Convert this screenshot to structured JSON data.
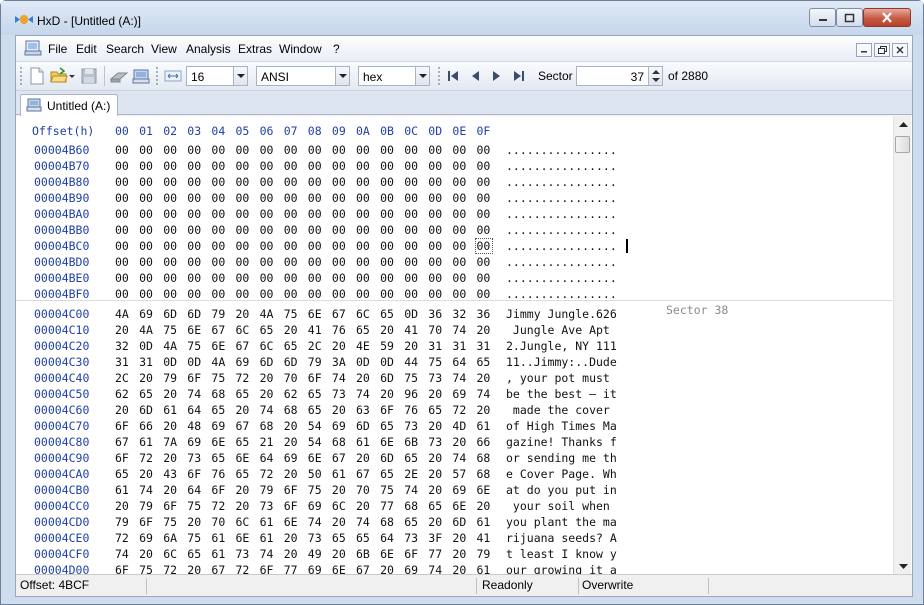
{
  "window": {
    "title": "HxD - [Untitled (A:)]",
    "icon": "hxd-app-icon"
  },
  "menu": {
    "items": [
      "File",
      "Edit",
      "Search",
      "View",
      "Analysis",
      "Extras",
      "Window",
      "?"
    ]
  },
  "toolbar": {
    "bytes_per_row": "16",
    "charset": "ANSI",
    "offset_base": "hex",
    "sector_label": "Sector",
    "sector_value": "37",
    "sector_total": "of 2880"
  },
  "tab": {
    "label": "Untitled (A:)"
  },
  "editor": {
    "offset_header": "Offset(h)",
    "column_headers": [
      "00",
      "01",
      "02",
      "03",
      "04",
      "05",
      "06",
      "07",
      "08",
      "09",
      "0A",
      "0B",
      "0C",
      "0D",
      "0E",
      "0F"
    ],
    "sector_marker": "Sector 38",
    "rows": [
      {
        "offset": "00004B60",
        "bytes": [
          "00",
          "00",
          "00",
          "00",
          "00",
          "00",
          "00",
          "00",
          "00",
          "00",
          "00",
          "00",
          "00",
          "00",
          "00",
          "00"
        ],
        "text": "................"
      },
      {
        "offset": "00004B70",
        "bytes": [
          "00",
          "00",
          "00",
          "00",
          "00",
          "00",
          "00",
          "00",
          "00",
          "00",
          "00",
          "00",
          "00",
          "00",
          "00",
          "00"
        ],
        "text": "................"
      },
      {
        "offset": "00004B80",
        "bytes": [
          "00",
          "00",
          "00",
          "00",
          "00",
          "00",
          "00",
          "00",
          "00",
          "00",
          "00",
          "00",
          "00",
          "00",
          "00",
          "00"
        ],
        "text": "................"
      },
      {
        "offset": "00004B90",
        "bytes": [
          "00",
          "00",
          "00",
          "00",
          "00",
          "00",
          "00",
          "00",
          "00",
          "00",
          "00",
          "00",
          "00",
          "00",
          "00",
          "00"
        ],
        "text": "................"
      },
      {
        "offset": "00004BA0",
        "bytes": [
          "00",
          "00",
          "00",
          "00",
          "00",
          "00",
          "00",
          "00",
          "00",
          "00",
          "00",
          "00",
          "00",
          "00",
          "00",
          "00"
        ],
        "text": "................"
      },
      {
        "offset": "00004BB0",
        "bytes": [
          "00",
          "00",
          "00",
          "00",
          "00",
          "00",
          "00",
          "00",
          "00",
          "00",
          "00",
          "00",
          "00",
          "00",
          "00",
          "00"
        ],
        "text": "................"
      },
      {
        "offset": "00004BC0",
        "bytes": [
          "00",
          "00",
          "00",
          "00",
          "00",
          "00",
          "00",
          "00",
          "00",
          "00",
          "00",
          "00",
          "00",
          "00",
          "00",
          "00"
        ],
        "text": "................"
      },
      {
        "offset": "00004BD0",
        "bytes": [
          "00",
          "00",
          "00",
          "00",
          "00",
          "00",
          "00",
          "00",
          "00",
          "00",
          "00",
          "00",
          "00",
          "00",
          "00",
          "00"
        ],
        "text": "................"
      },
      {
        "offset": "00004BE0",
        "bytes": [
          "00",
          "00",
          "00",
          "00",
          "00",
          "00",
          "00",
          "00",
          "00",
          "00",
          "00",
          "00",
          "00",
          "00",
          "00",
          "00"
        ],
        "text": "................"
      },
      {
        "offset": "00004BF0",
        "bytes": [
          "00",
          "00",
          "00",
          "00",
          "00",
          "00",
          "00",
          "00",
          "00",
          "00",
          "00",
          "00",
          "00",
          "00",
          "00",
          "00"
        ],
        "text": "................"
      },
      {
        "offset": "00004C00",
        "bytes": [
          "4A",
          "69",
          "6D",
          "6D",
          "79",
          "20",
          "4A",
          "75",
          "6E",
          "67",
          "6C",
          "65",
          "0D",
          "36",
          "32",
          "36"
        ],
        "text": "Jimmy Jungle.626"
      },
      {
        "offset": "00004C10",
        "bytes": [
          "20",
          "4A",
          "75",
          "6E",
          "67",
          "6C",
          "65",
          "20",
          "41",
          "76",
          "65",
          "20",
          "41",
          "70",
          "74",
          "20"
        ],
        "text": " Jungle Ave Apt "
      },
      {
        "offset": "00004C20",
        "bytes": [
          "32",
          "0D",
          "4A",
          "75",
          "6E",
          "67",
          "6C",
          "65",
          "2C",
          "20",
          "4E",
          "59",
          "20",
          "31",
          "31",
          "31"
        ],
        "text": "2.Jungle, NY 111"
      },
      {
        "offset": "00004C30",
        "bytes": [
          "31",
          "31",
          "0D",
          "0D",
          "4A",
          "69",
          "6D",
          "6D",
          "79",
          "3A",
          "0D",
          "0D",
          "44",
          "75",
          "64",
          "65"
        ],
        "text": "11..Jimmy:..Dude"
      },
      {
        "offset": "00004C40",
        "bytes": [
          "2C",
          "20",
          "79",
          "6F",
          "75",
          "72",
          "20",
          "70",
          "6F",
          "74",
          "20",
          "6D",
          "75",
          "73",
          "74",
          "20"
        ],
        "text": ", your pot must "
      },
      {
        "offset": "00004C50",
        "bytes": [
          "62",
          "65",
          "20",
          "74",
          "68",
          "65",
          "20",
          "62",
          "65",
          "73",
          "74",
          "20",
          "96",
          "20",
          "69",
          "74"
        ],
        "text": "be the best – it"
      },
      {
        "offset": "00004C60",
        "bytes": [
          "20",
          "6D",
          "61",
          "64",
          "65",
          "20",
          "74",
          "68",
          "65",
          "20",
          "63",
          "6F",
          "76",
          "65",
          "72",
          "20"
        ],
        "text": " made the cover "
      },
      {
        "offset": "00004C70",
        "bytes": [
          "6F",
          "66",
          "20",
          "48",
          "69",
          "67",
          "68",
          "20",
          "54",
          "69",
          "6D",
          "65",
          "73",
          "20",
          "4D",
          "61"
        ],
        "text": "of High Times Ma"
      },
      {
        "offset": "00004C80",
        "bytes": [
          "67",
          "61",
          "7A",
          "69",
          "6E",
          "65",
          "21",
          "20",
          "54",
          "68",
          "61",
          "6E",
          "6B",
          "73",
          "20",
          "66"
        ],
        "text": "gazine! Thanks f"
      },
      {
        "offset": "00004C90",
        "bytes": [
          "6F",
          "72",
          "20",
          "73",
          "65",
          "6E",
          "64",
          "69",
          "6E",
          "67",
          "20",
          "6D",
          "65",
          "20",
          "74",
          "68"
        ],
        "text": "or sending me th"
      },
      {
        "offset": "00004CA0",
        "bytes": [
          "65",
          "20",
          "43",
          "6F",
          "76",
          "65",
          "72",
          "20",
          "50",
          "61",
          "67",
          "65",
          "2E",
          "20",
          "57",
          "68"
        ],
        "text": "e Cover Page. Wh"
      },
      {
        "offset": "00004CB0",
        "bytes": [
          "61",
          "74",
          "20",
          "64",
          "6F",
          "20",
          "79",
          "6F",
          "75",
          "20",
          "70",
          "75",
          "74",
          "20",
          "69",
          "6E"
        ],
        "text": "at do you put in"
      },
      {
        "offset": "00004CC0",
        "bytes": [
          "20",
          "79",
          "6F",
          "75",
          "72",
          "20",
          "73",
          "6F",
          "69",
          "6C",
          "20",
          "77",
          "68",
          "65",
          "6E",
          "20"
        ],
        "text": " your soil when "
      },
      {
        "offset": "00004CD0",
        "bytes": [
          "79",
          "6F",
          "75",
          "20",
          "70",
          "6C",
          "61",
          "6E",
          "74",
          "20",
          "74",
          "68",
          "65",
          "20",
          "6D",
          "61"
        ],
        "text": "you plant the ma"
      },
      {
        "offset": "00004CE0",
        "bytes": [
          "72",
          "69",
          "6A",
          "75",
          "61",
          "6E",
          "61",
          "20",
          "73",
          "65",
          "65",
          "64",
          "73",
          "3F",
          "20",
          "41"
        ],
        "text": "rijuana seeds? A"
      },
      {
        "offset": "00004CF0",
        "bytes": [
          "74",
          "20",
          "6C",
          "65",
          "61",
          "73",
          "74",
          "20",
          "49",
          "20",
          "6B",
          "6E",
          "6F",
          "77",
          "20",
          "79"
        ],
        "text": "t least I know y"
      },
      {
        "offset": "00004D00",
        "bytes": [
          "6F",
          "75",
          "72",
          "20",
          "67",
          "72",
          "6F",
          "77",
          "69",
          "6E",
          "67",
          "20",
          "69",
          "74",
          "20",
          "61"
        ],
        "text": "our growing it a"
      }
    ]
  },
  "status": {
    "offset": "Offset: 4BCF",
    "mode": "Readonly",
    "insert_mode": "Overwrite"
  }
}
